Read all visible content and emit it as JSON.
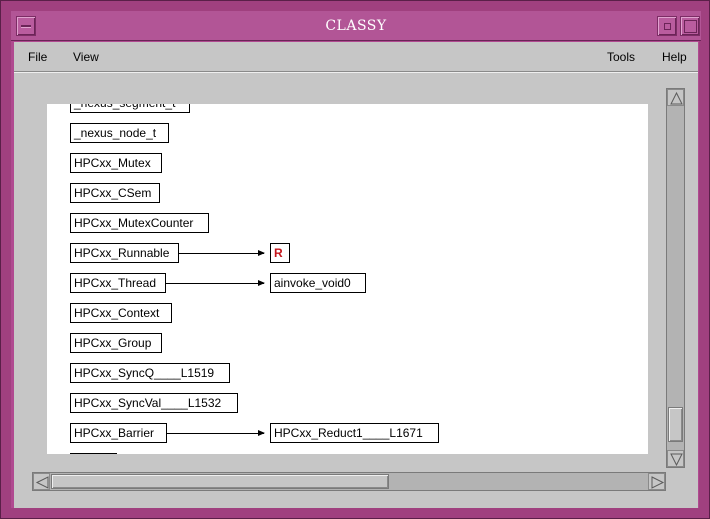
{
  "window": {
    "title": "CLASSY"
  },
  "menubar": {
    "items": [
      {
        "label": "File"
      },
      {
        "label": "View"
      },
      {
        "label": "Tools"
      },
      {
        "label": "Help"
      }
    ]
  },
  "diagram": {
    "nodes": [
      {
        "label": "_nexus_segment_t"
      },
      {
        "label": "_nexus_node_t"
      },
      {
        "label": "HPCxx_Mutex"
      },
      {
        "label": "HPCxx_CSem"
      },
      {
        "label": "HPCxx_MutexCounter"
      },
      {
        "label": "HPCxx_Runnable"
      },
      {
        "label": "HPCxx_Thread"
      },
      {
        "label": "HPCxx_Context"
      },
      {
        "label": "HPCxx_Group"
      },
      {
        "label": "HPCxx_SyncQ____L1519"
      },
      {
        "label": "HPCxx_SyncVal____L1532"
      },
      {
        "label": "HPCxx_Barrier"
      }
    ],
    "children": [
      {
        "label": "R",
        "parent": "HPCxx_Runnable",
        "highlight": true
      },
      {
        "label": "ainvoke_void0",
        "parent": "HPCxx_Thread"
      },
      {
        "label": "HPCxx_Reduct1____L1671",
        "parent": "HPCxx_Barrier"
      }
    ]
  },
  "colors": {
    "frame": "#a0407f",
    "titlebar": "#b25596",
    "client_bg": "#c6c6c6",
    "highlight_text": "#c4161c"
  },
  "icons": {
    "window_menu": "window-menu-icon",
    "minimize": "minimize-icon",
    "maximize": "maximize-icon",
    "scroll_up": "arrow-up-icon",
    "scroll_down": "arrow-down-icon",
    "scroll_left": "arrow-left-icon",
    "scroll_right": "arrow-right-icon"
  }
}
